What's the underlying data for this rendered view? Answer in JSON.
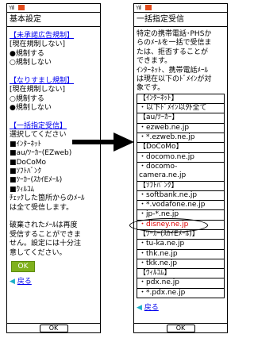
{
  "left": {
    "title": "基本設定",
    "items": [
      {
        "text": "【未承諾広告規制】",
        "link": true
      },
      {
        "text": "[現在規制しない]"
      },
      {
        "text": "●規制する"
      },
      {
        "text": "○規制しない"
      },
      {
        "text": ""
      },
      {
        "text": "【なりすまし規制】",
        "link": true
      },
      {
        "text": "[現在規制しない]"
      },
      {
        "text": "○規制する"
      },
      {
        "text": "●規制しない"
      },
      {
        "text": ""
      },
      {
        "text": "【一括指定受信】",
        "link": true
      },
      {
        "text": "選択してください"
      },
      {
        "text": "■ｲﾝﾀｰﾈｯﾄ"
      },
      {
        "text": "■au/ﾂｰｶｰ(EZweb)"
      },
      {
        "text": "■DoCoMo"
      },
      {
        "text": "■ｿﾌﾄﾊﾞﾝｸ"
      },
      {
        "text": "■ﾂｰｶｰ(ｽｶｲEﾒｰﾙ)"
      },
      {
        "text": "■ｳｨﾙｺﾑ"
      },
      {
        "text": "ﾁｪｯｸした箇所からのﾒｰﾙ"
      },
      {
        "text": "は全て受信します。"
      },
      {
        "text": ""
      },
      {
        "text": "破棄されたﾒｰﾙは再度"
      },
      {
        "text": "受信することができま"
      },
      {
        "text": "せん。設定には十分注"
      },
      {
        "text": "意してください。"
      }
    ],
    "ok_label": "OK",
    "back_arrow": "◀",
    "back_label": "戻る",
    "softkey": "OK"
  },
  "right": {
    "title": "一括指定受信",
    "intro": [
      "特定の携帯電話･PHSか",
      "らのﾒｰﾙを一括で受信ま",
      "たは、拒否することが",
      "できます。",
      "ｲﾝﾀｰﾈｯﾄ、携帯電話ﾒｰﾙ",
      "は現在以下のﾄﾞﾒｲﾝが対",
      "象です。"
    ],
    "sections": [
      {
        "header": "【ｲﾝﾀｰﾈｯﾄ】",
        "rows": [
          "・以下ﾄﾞﾒｲﾝ以外全て"
        ]
      },
      {
        "header": "【au/ﾂｰｶｰ】",
        "rows": [
          "・ezweb.ne.jp",
          "・*.ezweb.ne.jp"
        ]
      },
      {
        "header": "【DoCoMo】",
        "rows": [
          "・docomo.ne.jp",
          "・docomo-camera.ne.jp"
        ]
      },
      {
        "header": "【ｿﾌﾄﾊﾞﾝｸ】",
        "rows": [
          "・softbank.ne.jp",
          "・*.vodafone.ne.jp",
          "・jp-*.ne.jp",
          "・disney.ne.jp"
        ]
      },
      {
        "header": "【ﾂｰｶｰ(ｽｶｲEﾒｰﾙ)】",
        "rows": [
          "・tu-ka.ne.jp",
          "・thk.ne.jp",
          "・tkk.ne.jp"
        ]
      },
      {
        "header": "【ｳｨﾙｺﾑ】",
        "rows": [
          "・pdx.ne.jp",
          "・*.pdx.ne.jp"
        ]
      }
    ],
    "back_arrow": "◀",
    "back_label": "戻る",
    "softkey": "OK"
  },
  "status": {
    "signal": "Yıll"
  },
  "colors": {
    "link": "#0000ee",
    "ok_button": "#7fb11c",
    "back_arrow": "#1bb0c8",
    "mail_icon": "#e24b1b",
    "highlight": "#dd0000"
  }
}
